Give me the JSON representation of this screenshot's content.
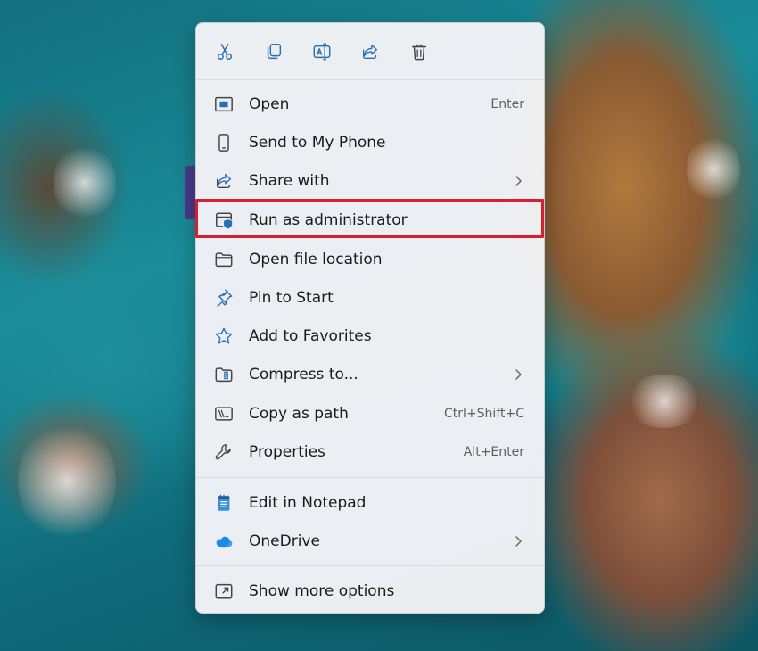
{
  "context_menu": {
    "toolbar": [
      {
        "id": "cut",
        "icon": "scissors-icon"
      },
      {
        "id": "copy",
        "icon": "copy-icon"
      },
      {
        "id": "rename",
        "icon": "rename-icon"
      },
      {
        "id": "share",
        "icon": "share-icon"
      },
      {
        "id": "delete",
        "icon": "trash-icon"
      }
    ],
    "items": [
      {
        "label": "Open",
        "shortcut": "Enter",
        "icon": "open-window-icon",
        "submenu": false
      },
      {
        "label": "Send to My Phone",
        "shortcut": "",
        "icon": "phone-icon",
        "submenu": false
      },
      {
        "label": "Share with",
        "shortcut": "",
        "icon": "share-icon",
        "submenu": true
      },
      {
        "label": "Run as administrator",
        "shortcut": "",
        "icon": "shield-window-icon",
        "submenu": false,
        "highlighted": true
      },
      {
        "label": "Open file location",
        "shortcut": "",
        "icon": "folder-icon",
        "submenu": false
      },
      {
        "label": "Pin to Start",
        "shortcut": "",
        "icon": "pin-icon",
        "submenu": false
      },
      {
        "label": "Add to Favorites",
        "shortcut": "",
        "icon": "star-icon",
        "submenu": false
      },
      {
        "label": "Compress to...",
        "shortcut": "",
        "icon": "zip-folder-icon",
        "submenu": true
      },
      {
        "label": "Copy as path",
        "shortcut": "Ctrl+Shift+C",
        "icon": "path-icon",
        "submenu": false
      },
      {
        "label": "Properties",
        "shortcut": "Alt+Enter",
        "icon": "wrench-icon",
        "submenu": false
      },
      {
        "label": "Edit in Notepad",
        "shortcut": "",
        "icon": "notepad-icon",
        "submenu": false
      },
      {
        "label": "OneDrive",
        "shortcut": "",
        "icon": "cloud-icon",
        "submenu": true
      },
      {
        "label": "Show more options",
        "shortcut": "",
        "icon": "expand-icon",
        "submenu": false
      }
    ]
  },
  "colors": {
    "accent": "#0067c0",
    "highlight_border": "#d6202f",
    "menu_background": "#f3f3f6"
  }
}
